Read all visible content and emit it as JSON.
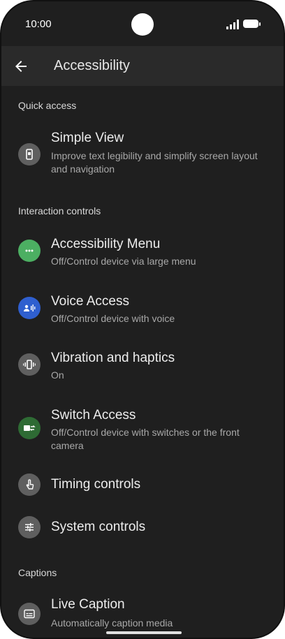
{
  "status": {
    "time": "10:00"
  },
  "header": {
    "title": "Accessibility"
  },
  "sections": {
    "quick_access": "Quick access",
    "interaction_controls": "Interaction controls",
    "captions": "Captions"
  },
  "items": {
    "simple_view": {
      "title": "Simple View",
      "subtitle": "Improve text legibility and simplify screen layout and navigation"
    },
    "accessibility_menu": {
      "title": "Accessibility Menu",
      "subtitle": "Off/Control device via large menu"
    },
    "voice_access": {
      "title": "Voice Access",
      "subtitle": "Off/Control device with voice"
    },
    "vibration": {
      "title": "Vibration and haptics",
      "subtitle": "On"
    },
    "switch_access": {
      "title": "Switch Access",
      "subtitle": "Off/Control device with switches or the front camera"
    },
    "timing_controls": {
      "title": "Timing controls"
    },
    "system_controls": {
      "title": "System controls"
    },
    "live_caption": {
      "title": "Live Caption",
      "subtitle": "Automatically caption media"
    }
  },
  "colors": {
    "background": "#1f1f1f",
    "appbar": "#2a2a2a",
    "icon_grey": "#5f5f5f",
    "accessibility_menu_green": "#4caf62",
    "voice_access_blue": "#2f5fcf",
    "switch_access_green": "#2e6b34"
  }
}
